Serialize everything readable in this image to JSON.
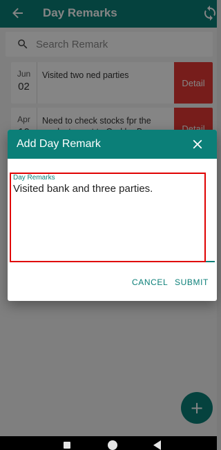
{
  "appbar": {
    "title": "Day Remarks",
    "back_icon": "arrow-left-icon",
    "sync_icon": "sync-icon"
  },
  "search": {
    "placeholder": "Search Remark",
    "icon": "search-icon"
  },
  "remarks": [
    {
      "month": "Jun",
      "day": "02",
      "text": "Visited two ned parties",
      "action": "Detail"
    },
    {
      "month": "Apr",
      "day": "10",
      "text": "Need to check stocks fpr the products sent to Garkha Ba",
      "action": "Detail"
    }
  ],
  "fab": {
    "label": "+"
  },
  "dialog": {
    "title": "Add Day Remark",
    "close_icon": "close-icon",
    "field_label": "Day Remarks",
    "field_value": "Visited bank and three parties.",
    "cancel_label": "CANCEL",
    "submit_label": "SUBMIT"
  },
  "colors": {
    "primary": "#0b7f78",
    "detail_button": "#e53935",
    "highlight": "#e00000"
  }
}
